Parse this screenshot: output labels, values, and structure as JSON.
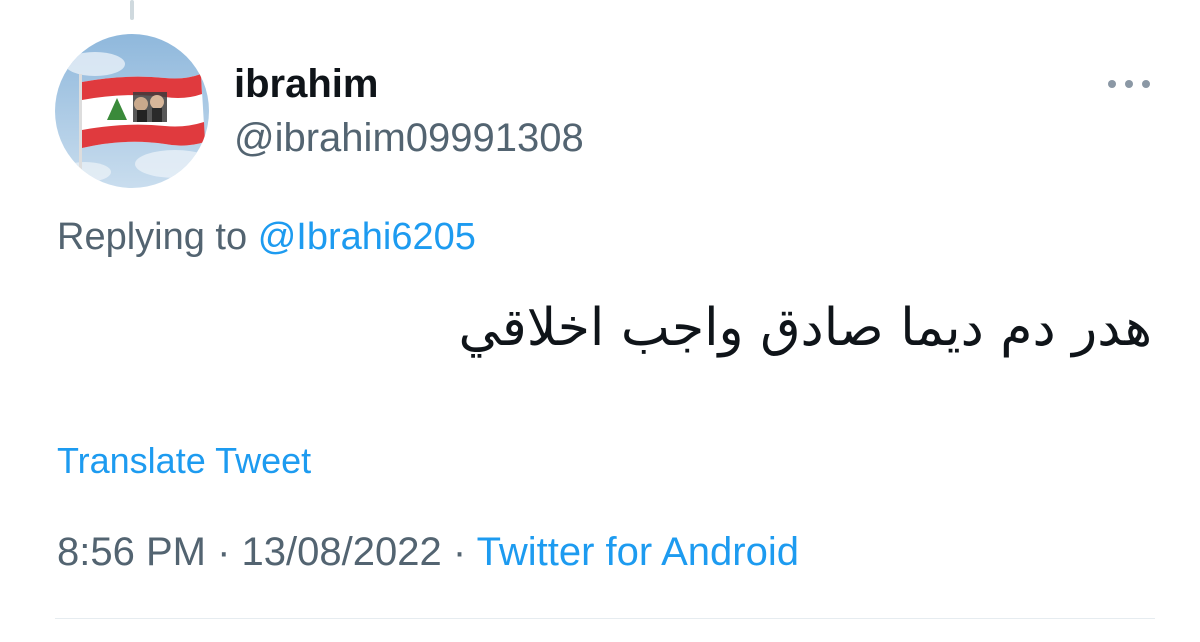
{
  "tweet": {
    "display_name": "ibrahim",
    "handle": "@ibrahim09991308",
    "replying_prefix": "Replying to",
    "replying_to": "@Ibrahi6205",
    "text": "هدر دم ديما صادق واجب اخلاقي",
    "translate_label": "Translate Tweet",
    "time": "8:56 PM",
    "separator": "·",
    "date": "13/08/2022",
    "source": "Twitter for Android"
  },
  "icons": {
    "more": "more-options-icon",
    "avatar": "avatar-lebanon-flag-image"
  },
  "colors": {
    "link": "#1d9bf0",
    "secondary_text": "#536471",
    "primary_text": "#0f1419",
    "divider": "#e6ecf0",
    "flag_red": "#e03a3e",
    "flag_cedar": "#3a8a3a",
    "sky": "#a9cbe6"
  }
}
